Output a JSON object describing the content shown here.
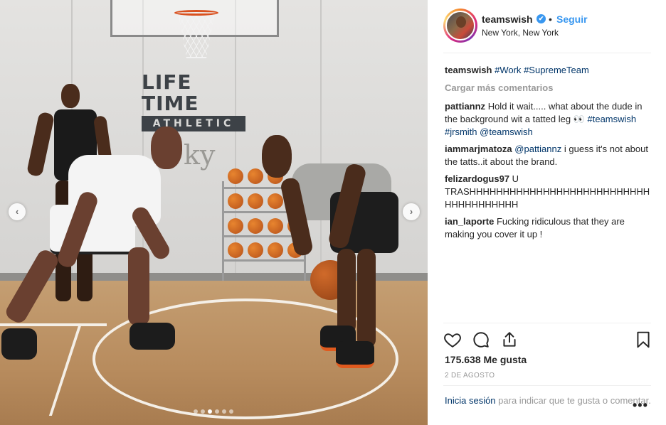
{
  "post": {
    "username": "teamswish",
    "verified_glyph": "✔",
    "separator": "•",
    "follow_label": "Seguir",
    "location": "New York, New York",
    "caption": {
      "user": "teamswish",
      "tags": [
        "#Work",
        "#SupremeTeam"
      ]
    },
    "load_more": "Cargar más comentarios",
    "comments": [
      {
        "user": "pattiannz",
        "text": "Hold it wait..... what about the dude in the background wit a tatted leg 👀",
        "tags": [
          "#teamswish",
          "#jrsmith",
          "@teamswish"
        ]
      },
      {
        "user": "iammarjmatoza",
        "mention": "@pattiannz",
        "text": "i guess it's not about the tatts..it about the brand."
      },
      {
        "user": "felizardogus97",
        "text": "U TRASHHHHHHHHHHHHHHHHHHHHHHHHHHHHHHHHHHHHHH"
      },
      {
        "user": "ian_laporte",
        "text": "Fucking ridiculous that they are making you cover it up !"
      }
    ],
    "likes": "175.638 Me gusta",
    "date": "2 DE AGOSTO",
    "login_link": "Inicia sesión",
    "login_text": "para indicar que te gusta o comentar.",
    "more_icon": "•••"
  },
  "photo": {
    "brand_top": "LIFE TIME",
    "brand_bottom": "ATHLETIC",
    "wall_mark": "ky",
    "prev_glyph": "‹",
    "next_glyph": "›",
    "carousel_count": 6,
    "carousel_active": 2
  },
  "icons": {
    "like": "heart-icon",
    "comment": "comment-icon",
    "share": "share-icon",
    "save": "bookmark-icon"
  },
  "colors": {
    "link_blue": "#3897f0",
    "tag_blue": "#003569",
    "muted": "#999999"
  }
}
